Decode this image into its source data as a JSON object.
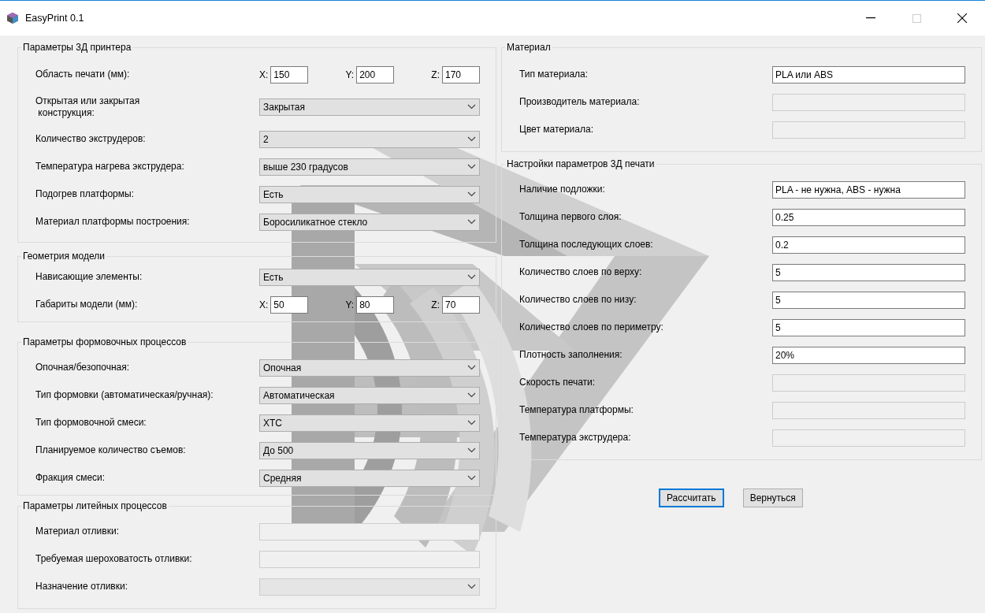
{
  "window": {
    "title": "EasyPrint 0.1",
    "maximize_disabled": true
  },
  "left_groups": [
    {
      "title": "Параметры 3Д принтера",
      "rows": [
        {
          "kind": "xyz",
          "label": "Область печати (мм):",
          "axes": [
            {
              "axis": "X:",
              "value": "150"
            },
            {
              "axis": "Y:",
              "value": "200"
            },
            {
              "axis": "Z:",
              "value": "170"
            }
          ]
        },
        {
          "kind": "combo",
          "label": "Открытая или закрытая\n конструкция:",
          "value": "Закрытая",
          "disabled": false
        },
        {
          "kind": "combo",
          "label": "Количество экструдеров:",
          "value": "2",
          "disabled": false
        },
        {
          "kind": "combo",
          "label": "Температура нагрева экструдера:",
          "value": "выше 230 градусов",
          "disabled": false
        },
        {
          "kind": "combo",
          "label": "Подогрев платформы:",
          "value": "Есть",
          "disabled": false
        },
        {
          "kind": "combo",
          "label": "Материал платформы построения:",
          "value": "Боросиликатное стекло",
          "disabled": false
        }
      ]
    },
    {
      "title": "Геометрия модели",
      "rows": [
        {
          "kind": "combo",
          "label": "Нависающие элементы:",
          "value": "Есть",
          "disabled": false
        },
        {
          "kind": "xyz",
          "label": "Габариты модели (мм):",
          "axes": [
            {
              "axis": "X:",
              "value": "50"
            },
            {
              "axis": "Y:",
              "value": "80"
            },
            {
              "axis": "Z:",
              "value": "70"
            }
          ]
        }
      ]
    },
    {
      "title": "Параметры формовочных процессов",
      "rows": [
        {
          "kind": "combo",
          "label": "Опочная/безопочная:",
          "value": "Опочная",
          "disabled": false
        },
        {
          "kind": "combo",
          "label": "Тип формовки (автоматическая/ручная):",
          "value": "Автоматическая",
          "disabled": false
        },
        {
          "kind": "combo",
          "label": "Тип формовочной смеси:",
          "value": "ХТС",
          "disabled": false
        },
        {
          "kind": "combo",
          "label": "Планируемое количество съемов:",
          "value": "До 500",
          "disabled": false
        },
        {
          "kind": "combo",
          "label": "Фракция смеси:",
          "value": "Средняя",
          "disabled": false
        }
      ]
    },
    {
      "title": "Параметры литейных процессов",
      "rows": [
        {
          "kind": "text",
          "label": "Материал отливки:",
          "disabled": true
        },
        {
          "kind": "text",
          "label": "Требуемая шероховатость отливки:",
          "disabled": true
        },
        {
          "kind": "combo",
          "label": "Назначение отливки:",
          "disabled": true
        }
      ]
    }
  ],
  "right_groups": [
    {
      "title": "Материал",
      "rows": [
        {
          "kind": "text",
          "label": "Тип материала:",
          "value": "PLA или ABS",
          "disabled": false
        },
        {
          "kind": "text",
          "label": "Производитель материала:",
          "disabled": true
        },
        {
          "kind": "text",
          "label": "Цвет материала:",
          "disabled": true
        }
      ]
    },
    {
      "title": "Настройки параметров 3Д печати",
      "rows": [
        {
          "kind": "text",
          "label": "Наличие подложки:",
          "value": "PLA - не нужна, ABS - нужна",
          "disabled": false
        },
        {
          "kind": "text",
          "label": "Толщина первого слоя:",
          "value": "0.25",
          "disabled": false
        },
        {
          "kind": "text",
          "label": "Толщина последующих слоев:",
          "value": "0.2",
          "disabled": false
        },
        {
          "kind": "text",
          "label": "Количество слоев по верху:",
          "value": "5",
          "disabled": false
        },
        {
          "kind": "text",
          "label": "Количество слоев по низу:",
          "value": "5",
          "disabled": false
        },
        {
          "kind": "text",
          "label": "Количество слоев по периметру:",
          "value": "5",
          "disabled": false
        },
        {
          "kind": "text",
          "label": "Плотность заполнения:",
          "value": "20%",
          "disabled": false
        },
        {
          "kind": "text",
          "label": "Скорость печати:",
          "disabled": true
        },
        {
          "kind": "text",
          "label": "Температура платформы:",
          "disabled": true
        },
        {
          "kind": "text",
          "label": "Температура экструдера:",
          "disabled": true
        }
      ]
    }
  ],
  "buttons": [
    {
      "label": "Рассчитать",
      "default": true
    },
    {
      "label": "Вернуться",
      "default": false
    }
  ]
}
